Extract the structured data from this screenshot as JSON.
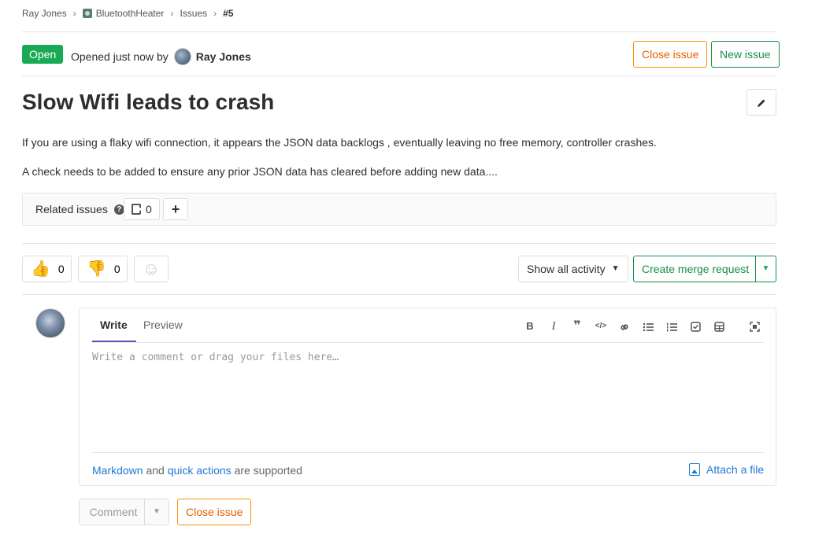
{
  "breadcrumb": {
    "user": "Ray Jones",
    "project": "BluetoothHeater",
    "section": "Issues",
    "current": "#5"
  },
  "issue": {
    "status": "Open",
    "opened_prefix": "Opened just now by",
    "author": "Ray Jones",
    "title": "Slow Wifi leads to crash",
    "description": [
      "If you are using a flaky wifi connection, it appears the JSON data backlogs , eventually leaving no free memory, controller crashes.",
      "A check needs to be added to ensure any prior JSON data has cleared before adding new data...."
    ]
  },
  "header_actions": {
    "close_issue": "Close issue",
    "new_issue": "New issue"
  },
  "related": {
    "label": "Related issues",
    "count": "0"
  },
  "awards": {
    "thumbsup_count": "0",
    "thumbsdown_count": "0"
  },
  "activity": {
    "filter_label": "Show all activity",
    "merge_request_label": "Create merge request"
  },
  "comment": {
    "tab_write": "Write",
    "tab_preview": "Preview",
    "placeholder": "Write a comment or drag your files here…",
    "footer_markdown": "Markdown",
    "footer_and": "and",
    "footer_quick_actions": "quick actions",
    "footer_supported": "are supported",
    "attach_label": "Attach a file",
    "submit_label": "Comment",
    "close_label": "Close issue"
  },
  "colors": {
    "open_badge": "#1aaa55",
    "warning": "#fc9403",
    "success": "#168f48",
    "link": "#1f78d1",
    "tab_active": "#6b4fbb"
  },
  "icons": [
    "chevron-right-icon",
    "project-avatar-icon",
    "user-avatar-icon",
    "pencil-icon",
    "question-circle-icon",
    "issues-icon",
    "plus-icon",
    "thumbsup-icon",
    "thumbsdown-icon",
    "smiley-icon",
    "chevron-down-icon",
    "bold-icon",
    "italic-icon",
    "quote-icon",
    "code-icon",
    "link-icon",
    "bullet-list-icon",
    "numbered-list-icon",
    "task-list-icon",
    "table-icon",
    "fullscreen-icon",
    "image-icon"
  ]
}
